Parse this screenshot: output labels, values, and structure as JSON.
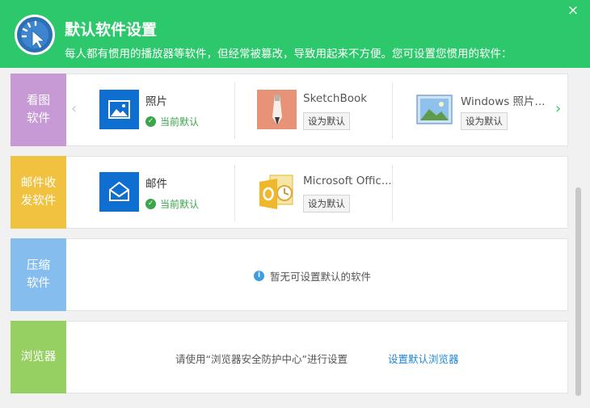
{
  "header": {
    "title": "默认软件设置",
    "subtitle": "每人都有惯用的播放器等软件，但经常被篡改，导致用起来不方便。您可设置您惯用的软件：",
    "close_glyph": "×",
    "background": "#2dc86b"
  },
  "rows": [
    {
      "category": "看图\n软件",
      "color": "#c79ad6",
      "prev_glyph": "‹",
      "next_glyph": "›",
      "apps": [
        {
          "name": "照片",
          "icon": "photos-icon",
          "status": "当前默认"
        },
        {
          "name": "SketchBook",
          "icon": "sketchbook-icon",
          "button": "设为默认"
        },
        {
          "name": "Windows 照片...",
          "icon": "windows-photo-viewer-icon",
          "button": "设为默认"
        }
      ]
    },
    {
      "category": "邮件收\n发软件",
      "color": "#f1c240",
      "apps": [
        {
          "name": "邮件",
          "icon": "mail-icon",
          "status": "当前默认"
        },
        {
          "name": "Microsoft Offic...",
          "icon": "outlook-icon",
          "button": "设为默认"
        }
      ]
    },
    {
      "category": "压缩\n软件",
      "color": "#84bdee",
      "notice": "暂无可设置默认的软件"
    },
    {
      "category": "浏览器",
      "color": "#96d062",
      "text": "请使用“浏览器安全防护中心”进行设置",
      "link": "设置默认浏览器"
    }
  ]
}
